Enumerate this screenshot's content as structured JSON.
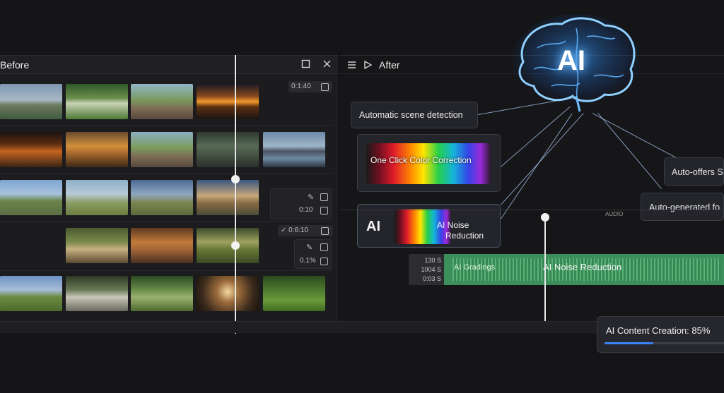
{
  "before_panel": {
    "title": "Before",
    "badges": {
      "row1": "0:1:40",
      "row3": "0:10",
      "row4_check": "✓ 0:6:10",
      "row4_value": "0.1%"
    }
  },
  "after_panel": {
    "title": "After",
    "labels": {
      "scene_detection": "Automatic scene detection",
      "color_correction": "One Click Color Correction",
      "noise_prefix": "AI",
      "noise_reduction_line1": "AI Noise",
      "noise_reduction_line2": "Reduction",
      "auto_offers": "Auto-offers S",
      "auto_generated": "Auto-generated fo"
    },
    "brain_text": "AI",
    "timeline": {
      "marker": "AUDIO",
      "times": [
        "130 S",
        "1004 S",
        "0:03 S"
      ],
      "track_label_left": "AI Gradings",
      "track_label_main": "AI Noise Reduction"
    }
  },
  "progress": {
    "label": "AI Content Creation: 85%",
    "percent": 85
  },
  "colors": {
    "accent": "#3b82f6",
    "track_green": "#3c8f5a",
    "brain_glow": "#3a8fff"
  }
}
